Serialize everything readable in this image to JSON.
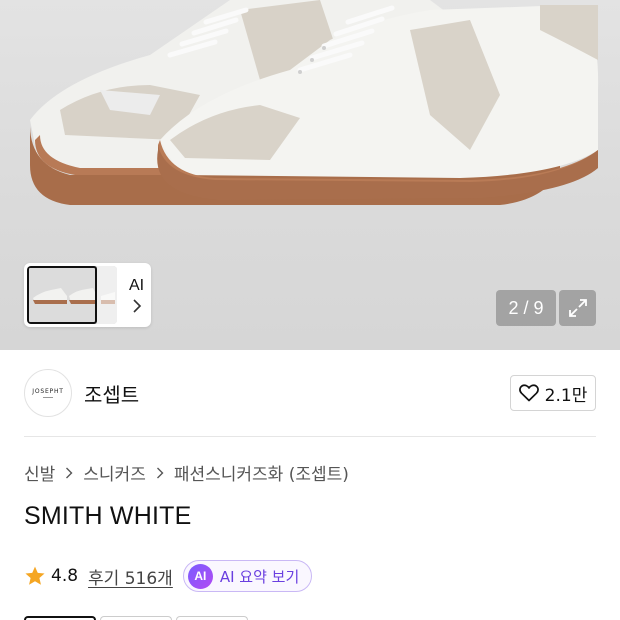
{
  "gallery": {
    "thumbnail_ai_label": "AI",
    "counter": "2 / 9"
  },
  "brand": {
    "logo_text": "JOSEPHT",
    "name": "조셉트",
    "likes": "2.1만"
  },
  "breadcrumb": [
    "신발",
    "스니커즈",
    "패션스니커즈화 (조셉트)"
  ],
  "product": {
    "title": "SMITH WHITE",
    "rating": "4.8",
    "reviews": "후기 516개",
    "ai_badge": "AI",
    "ai_summary": "AI 요약 보기"
  },
  "colors": {
    "star": "#f5a623",
    "ai_accent": "#7a5cff"
  },
  "icons": [
    "expand-icon",
    "heart-icon",
    "chevron-right-icon",
    "star-icon"
  ]
}
